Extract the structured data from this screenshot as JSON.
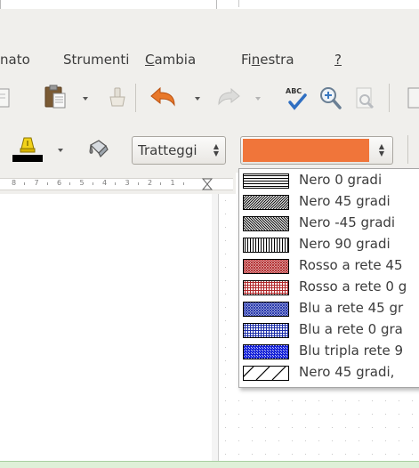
{
  "menubar": {
    "items": [
      {
        "label": "nato",
        "mnemonic": ""
      },
      {
        "label": "Strumenti",
        "mnemonic": ""
      },
      {
        "label": "Cambia",
        "mnemonic": "C"
      },
      {
        "label": "Finestra",
        "mnemonic": "n"
      },
      {
        "label": "?",
        "mnemonic": "?"
      }
    ]
  },
  "toolbar1": {
    "icons": [
      "copy-icon",
      "paste-icon",
      "clone-formatting-icon",
      "undo-icon",
      "redo-icon",
      "spellcheck-icon",
      "zoom-icon",
      "find-icon"
    ],
    "spellcheck_text": "ABC"
  },
  "toolbar2": {
    "fill_style_value": "Tratteggi",
    "fill_color": "#f0753a",
    "line_color": "#000000",
    "highlight_color": "#e8c000"
  },
  "ruler": {
    "labels": [
      "8",
      "7",
      "6",
      "5",
      "4",
      "3",
      "2",
      "1"
    ]
  },
  "hatch_list": {
    "items": [
      {
        "label": "Nero 0 gradi",
        "pattern": "h",
        "color": "#000000"
      },
      {
        "label": "Nero 45 gradi",
        "pattern": "d45",
        "color": "#000000"
      },
      {
        "label": "Nero -45 gradi",
        "pattern": "d-45",
        "color": "#000000"
      },
      {
        "label": "Nero 90 gradi",
        "pattern": "v",
        "color": "#000000"
      },
      {
        "label": "Rosso a rete 45",
        "pattern": "x45",
        "color": "#b0282a"
      },
      {
        "label": "Rosso a rete 0 g",
        "pattern": "grid",
        "color": "#b0282a"
      },
      {
        "label": "Blu a rete 45 gr",
        "pattern": "x45",
        "color": "#1c2ea8"
      },
      {
        "label": "Blu a rete 0 gra",
        "pattern": "grid",
        "color": "#1c2ea8"
      },
      {
        "label": "Blu tripla rete 9",
        "pattern": "triple",
        "color": "#1420d8"
      },
      {
        "label": "Nero 45 gradi,",
        "pattern": "wide45",
        "color": "#000000"
      }
    ]
  }
}
